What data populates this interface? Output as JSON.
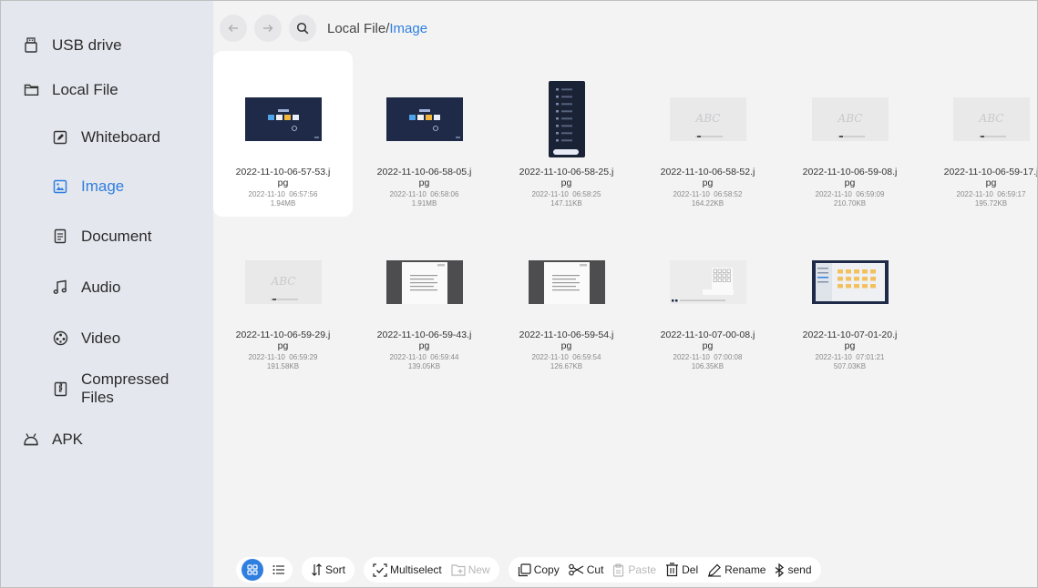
{
  "sidebar": {
    "items": [
      {
        "label": "USB drive",
        "icon": "usb-drive-icon"
      },
      {
        "label": "Local File",
        "icon": "folder-icon"
      },
      {
        "label": "Whiteboard",
        "icon": "whiteboard-icon"
      },
      {
        "label": "Image",
        "icon": "image-icon",
        "active": true
      },
      {
        "label": "Document",
        "icon": "document-icon"
      },
      {
        "label": "Audio",
        "icon": "music-note-icon"
      },
      {
        "label": "Video",
        "icon": "video-reel-icon"
      },
      {
        "label": "Compressed\nFiles",
        "icon": "zip-archive-icon"
      },
      {
        "label": "APK",
        "icon": "android-icon"
      }
    ]
  },
  "topbar": {
    "back_icon": "arrow-left-icon",
    "forward_icon": "arrow-right-icon",
    "search_icon": "search-icon",
    "breadcrumb_root": "Local File/",
    "breadcrumb_current": "Image"
  },
  "files": [
    {
      "name1": "2022-11-10-06-57-53.j",
      "name2": "pg",
      "date": "2022-11-10  06:57:56",
      "size": "1.94MB",
      "thumb": "desktop-dark",
      "selected": true
    },
    {
      "name1": "2022-11-10-06-58-05.j",
      "name2": "pg",
      "date": "2022-11-10  06:58:06",
      "size": "1.91MB",
      "thumb": "desktop-dark"
    },
    {
      "name1": "2022-11-10-06-58-25.j",
      "name2": "pg",
      "date": "2022-11-10  06:58:25",
      "size": "147.11KB",
      "thumb": "menu-panel"
    },
    {
      "name1": "2022-11-10-06-58-52.j",
      "name2": "pg",
      "date": "2022-11-10  06:58:52",
      "size": "164.22KB",
      "thumb": "whiteboard-abc"
    },
    {
      "name1": "2022-11-10-06-59-08.j",
      "name2": "pg",
      "date": "2022-11-10  06:59:09",
      "size": "210.70KB",
      "thumb": "whiteboard-abc"
    },
    {
      "name1": "2022-11-10-06-59-17.j",
      "name2": "pg",
      "date": "2022-11-10  06:59:17",
      "size": "195.72KB",
      "thumb": "whiteboard-abc"
    },
    {
      "name1": "2022-11-10-06-59-29.j",
      "name2": "pg",
      "date": "2022-11-10  06:59:29",
      "size": "191.58KB",
      "thumb": "whiteboard-abc"
    },
    {
      "name1": "2022-11-10-06-59-43.j",
      "name2": "pg",
      "date": "2022-11-10  06:59:44",
      "size": "139.05KB",
      "thumb": "document-page"
    },
    {
      "name1": "2022-11-10-06-59-54.j",
      "name2": "pg",
      "date": "2022-11-10  06:59:54",
      "size": "126.67KB",
      "thumb": "document-page"
    },
    {
      "name1": "2022-11-10-07-00-08.j",
      "name2": "pg",
      "date": "2022-11-10  07:00:08",
      "size": "106.35KB",
      "thumb": "whiteboard-tools"
    },
    {
      "name1": "2022-11-10-07-01-20.j",
      "name2": "pg",
      "date": "2022-11-10  07:01:21",
      "size": "507.03KB",
      "thumb": "file-manager"
    }
  ],
  "toolbar": {
    "sort": "Sort",
    "multiselect": "Multiselect",
    "new": "New",
    "copy": "Copy",
    "cut": "Cut",
    "paste": "Paste",
    "del": "Del",
    "rename": "Rename",
    "send": "send"
  },
  "colors": {
    "accent": "#2f7fe0",
    "sidebar_bg": "#e5e7ee",
    "main_bg": "#f3f3f4",
    "thumb_dark": "#1e2a47"
  }
}
